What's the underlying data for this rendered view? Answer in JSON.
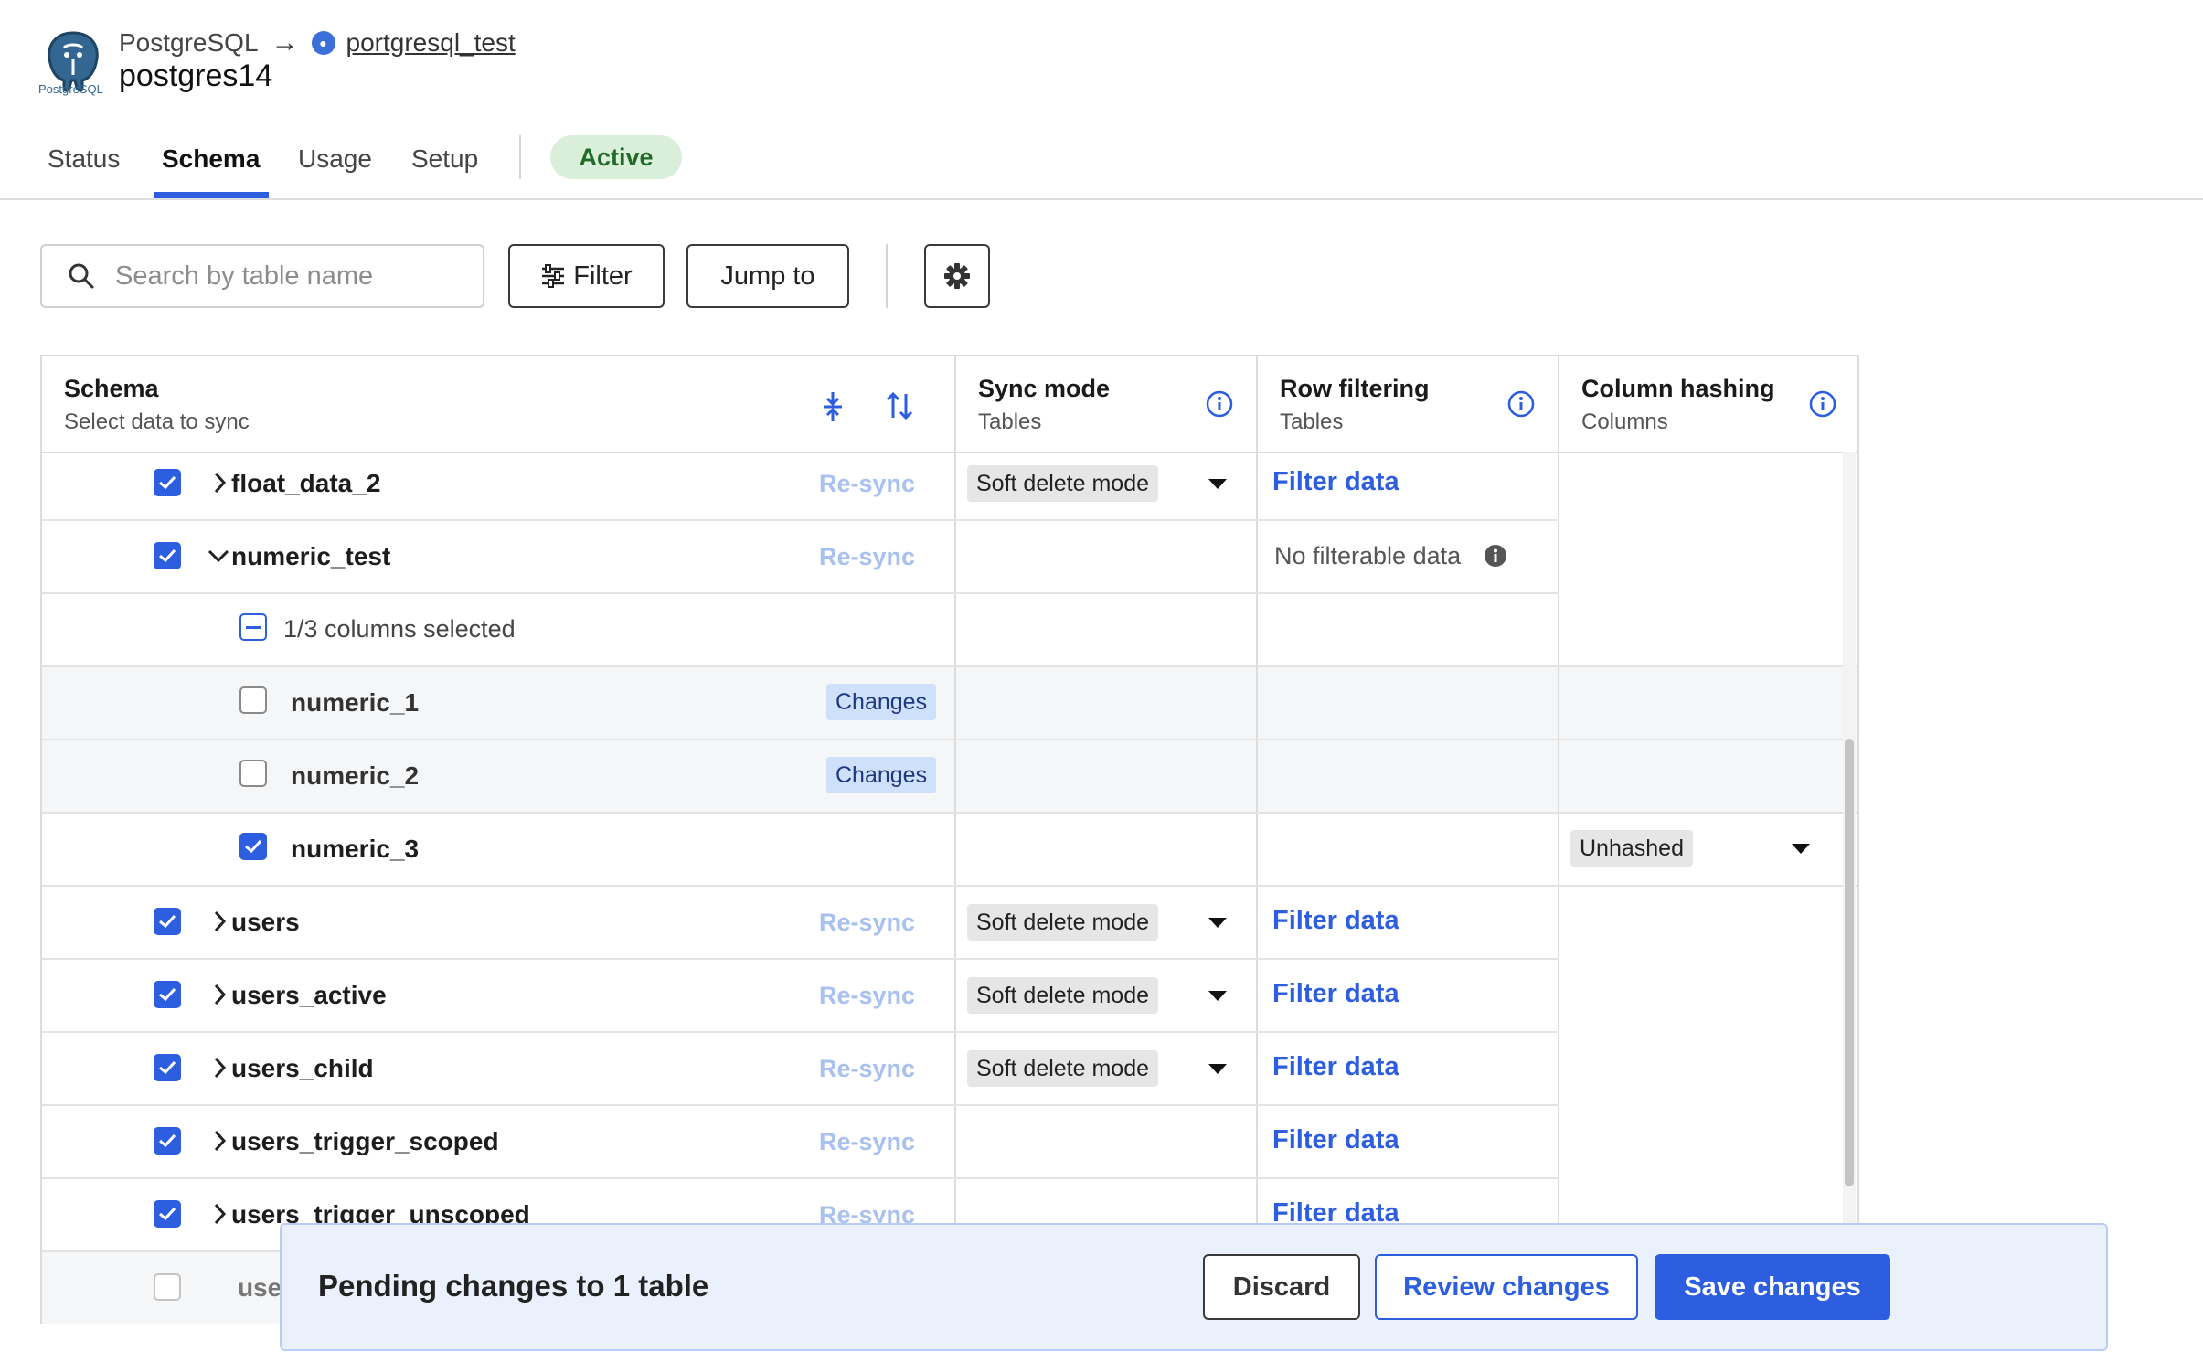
{
  "connector": {
    "source": "PostgreSQL",
    "destination_link": "portgresql_test",
    "name": "postgres14",
    "logo_caption": "PostgreSQL"
  },
  "tabs": [
    {
      "label": "Status",
      "active": false
    },
    {
      "label": "Schema",
      "active": true
    },
    {
      "label": "Usage",
      "active": false
    },
    {
      "label": "Setup",
      "active": false
    }
  ],
  "status_badge": "Active",
  "toolbar": {
    "search_placeholder": "Search by table name",
    "filter_label": "Filter",
    "jump_label": "Jump to"
  },
  "table": {
    "headers": {
      "schema": {
        "title": "Schema",
        "subtitle": "Select data to sync"
      },
      "sync_mode": {
        "title": "Sync mode",
        "subtitle": "Tables"
      },
      "row_filtering": {
        "title": "Row filtering",
        "subtitle": "Tables"
      },
      "column_hashing": {
        "title": "Column hashing",
        "subtitle": "Columns"
      }
    },
    "resync_label": "Re-sync",
    "changes_label": "Changes",
    "filter_data_label": "Filter data",
    "soft_delete_label": "Soft delete mode",
    "no_filterable_label": "No filterable data",
    "unhashed_label": "Unhashed",
    "columns_selected_label": "1/3 columns selected",
    "rows": [
      {
        "name": "float_data_2"
      },
      {
        "name": "numeric_test"
      },
      {
        "name": "numeric_1"
      },
      {
        "name": "numeric_2"
      },
      {
        "name": "numeric_3"
      },
      {
        "name": "users"
      },
      {
        "name": "users_active"
      },
      {
        "name": "users_child"
      },
      {
        "name": "users_trigger_scoped"
      },
      {
        "name": "users_trigger_unscoped"
      },
      {
        "name": "use"
      }
    ]
  },
  "footer": {
    "pending_text": "Pending changes to 1 table",
    "discard_label": "Discard",
    "review_label": "Review changes",
    "save_label": "Save changes"
  },
  "colors": {
    "accent": "#2d5ee0",
    "active_badge_bg": "#d9efd9",
    "active_badge_text": "#216b29",
    "pending_bar_bg": "#eaf1fd"
  }
}
